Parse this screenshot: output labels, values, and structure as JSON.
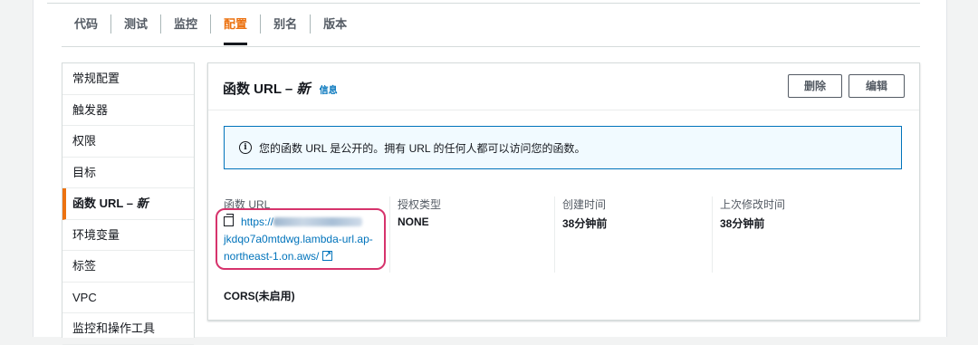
{
  "tabs": [
    "代码",
    "测试",
    "监控",
    "配置",
    "别名",
    "版本"
  ],
  "active_tab": "配置",
  "sidebar": {
    "items": [
      {
        "label": "常规配置"
      },
      {
        "label": "触发器"
      },
      {
        "label": "权限"
      },
      {
        "label": "目标"
      },
      {
        "label": "函数 URL – 新"
      },
      {
        "label": "环境变量"
      },
      {
        "label": "标签"
      },
      {
        "label": "VPC"
      },
      {
        "label": "监控和操作工具"
      }
    ],
    "active_index": 4
  },
  "card": {
    "title": "函数 URL –",
    "title_new": "新",
    "info_link": "信息",
    "delete_button": "删除",
    "edit_button": "编辑",
    "alert": "您的函数 URL 是公开的。拥有 URL 的任何人都可以访问您的函数。",
    "columns": {
      "url_label": "函数 URL",
      "url_line1_prefix": "https://",
      "url_line2": "jkdqo7a0mtdwg.lambda-url.ap-",
      "url_line3": "northeast-1.on.aws/",
      "auth_label": "授权类型",
      "auth_value": "NONE",
      "created_label": "创建时间",
      "created_value": "38分钟前",
      "modified_label": "上次修改时间",
      "modified_value": "38分钟前"
    },
    "cors": "CORS(未启用)"
  },
  "colors": {
    "accent": "#ec7211",
    "link": "#0073bb",
    "highlight": "#d6336c"
  }
}
